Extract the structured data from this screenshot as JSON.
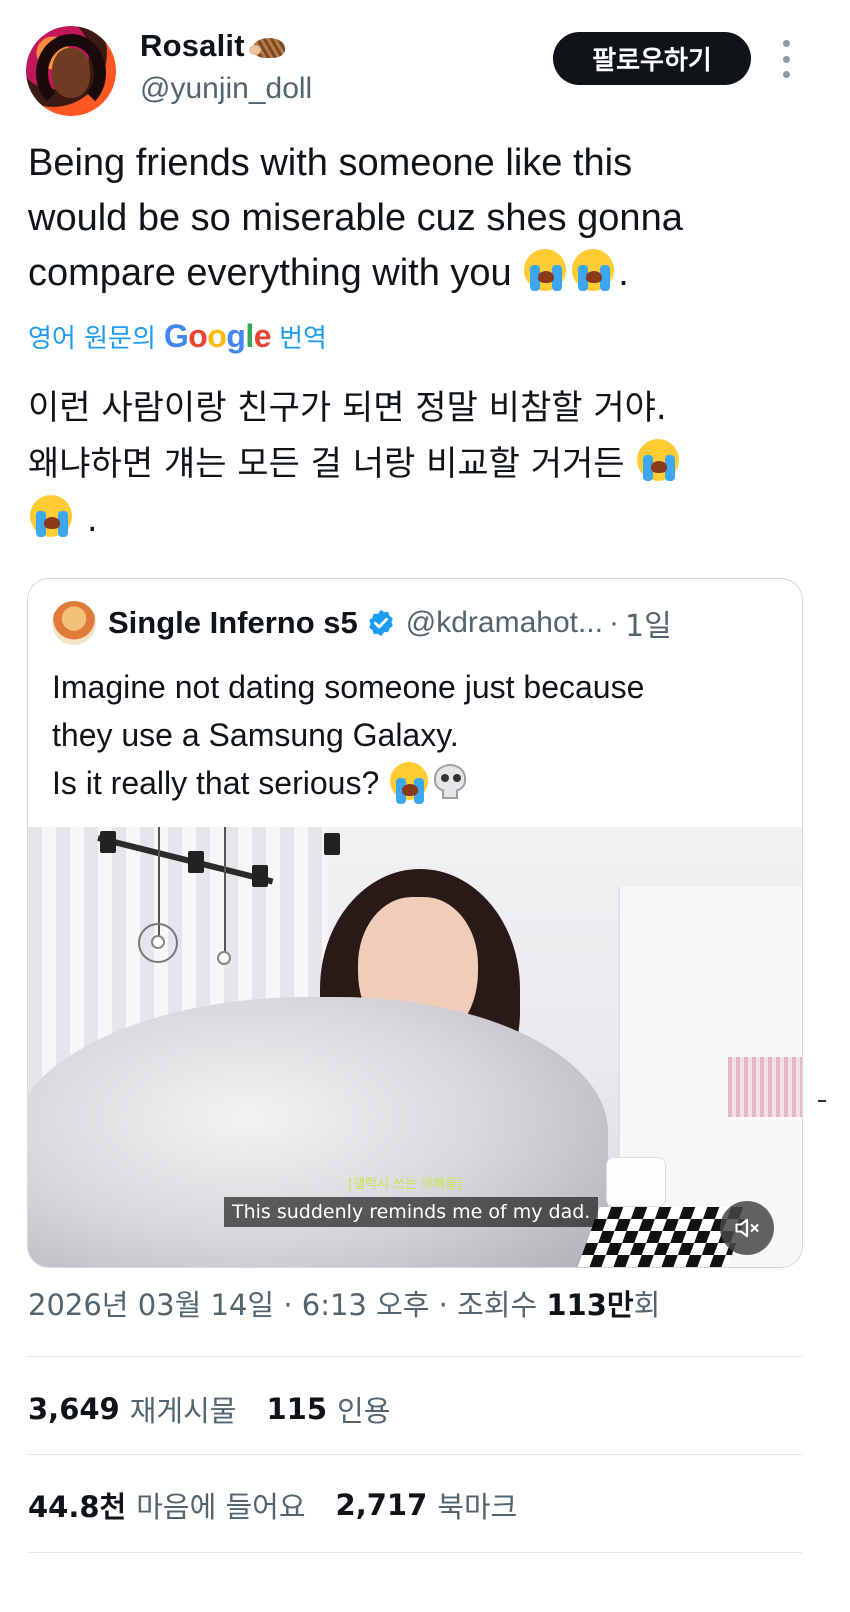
{
  "author": {
    "display_name": "Rosalit",
    "name_emoji": "hedgehog",
    "handle": "@yunjin_doll"
  },
  "follow_button": {
    "label": "팔로우하기"
  },
  "more_menu": {
    "icon": "more-vertical-icon"
  },
  "tweet": {
    "line1": "Being friends with someone like this",
    "line2": "would be so miserable cuz shes gonna",
    "line3": "compare everything with you",
    "end_punct": ".",
    "emojis": [
      "loudly-crying-face",
      "loudly-crying-face"
    ]
  },
  "translation": {
    "prefix": "영어 원문의",
    "google": "Google",
    "suffix": "번역",
    "line1": "이런 사람이랑 친구가 되면 정말 비참할 거야.",
    "line2": "왜냐하면 걔는 모든 걸 너랑 비교할 거거든",
    "end_punct": "."
  },
  "quoted_tweet": {
    "name": "Single Inferno s5",
    "verified": true,
    "handle": "@kdramahot...",
    "separator": "·",
    "time": "1일",
    "line1": "Imagine not dating someone just because",
    "line2": "they use a Samsung Galaxy.",
    "line3": "Is it really that serious?",
    "emojis": [
      "loudly-crying-face",
      "skull"
    ],
    "media": {
      "caption_kr": "[갤럭시 쓰는 아빠들]",
      "subtitle": "This suddenly reminds me of my dad.",
      "mute_icon": "speaker-muted-icon"
    }
  },
  "meta": {
    "date": "2026년 03월 14일",
    "sep1": "·",
    "time": "6:13 오후",
    "sep2": "·",
    "views_label": "조회수",
    "views_value": "113만",
    "views_suffix": "회"
  },
  "stats": {
    "reposts_value": "3,649",
    "reposts_label": "재게시물",
    "quotes_value": "115",
    "quotes_label": "인용",
    "likes_value": "44.8천",
    "likes_label": "마음에 들어요",
    "bookmarks_value": "2,717",
    "bookmarks_label": "북마크"
  },
  "colors": {
    "text": "#0f1419",
    "secondary": "#536471",
    "link": "#1d9bf0",
    "button_bg": "#0f1419",
    "border": "#cfd9de",
    "verified": "#1d9bf0"
  }
}
